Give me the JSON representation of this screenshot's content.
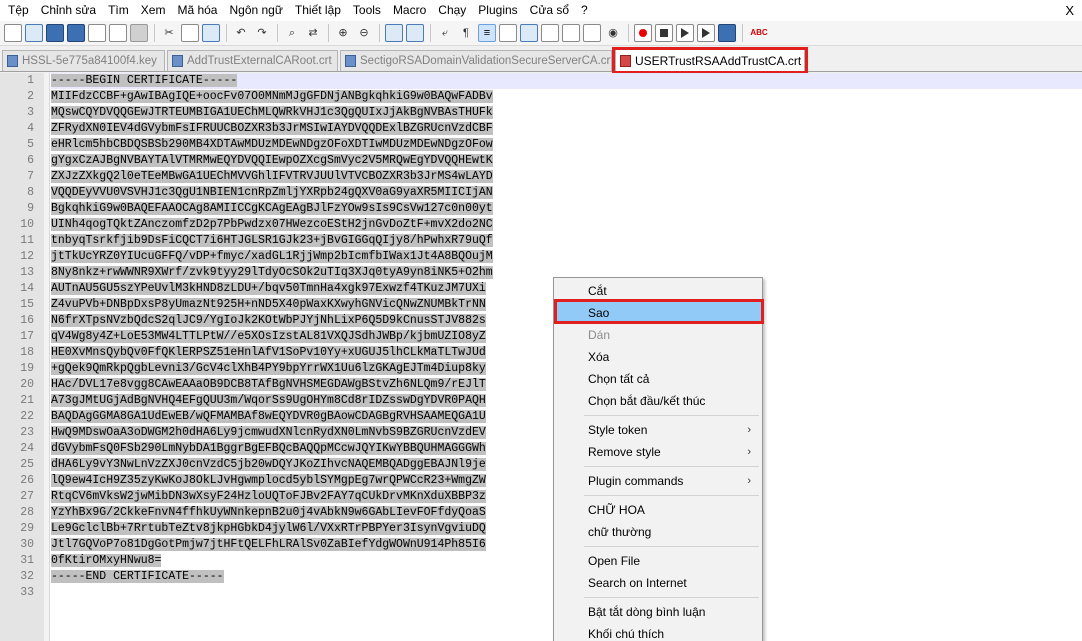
{
  "menu": {
    "items": [
      "Tệp",
      "Chỉnh sửa",
      "Tìm",
      "Xem",
      "Mã hóa",
      "Ngôn ngữ",
      "Thiết lập",
      "Tools",
      "Macro",
      "Chạy",
      "Plugins",
      "Cửa sổ",
      "?"
    ],
    "close_symbol": "X"
  },
  "toolbar": {
    "spellcheck_label": "ABC"
  },
  "tabs": [
    {
      "label": "HSSL-5e775a84100f4.key",
      "active": false
    },
    {
      "label": "AddTrustExternalCARoot.crt",
      "active": false
    },
    {
      "label": "SectigoRSADomainValidationSecureServerCA.crt",
      "active": false
    },
    {
      "label": "USERTrustRSAAddTrustCA.crt",
      "active": true,
      "close": "✕"
    }
  ],
  "editor": {
    "line_numbers": [
      "1",
      "2",
      "3",
      "4",
      "5",
      "6",
      "7",
      "8",
      "9",
      "10",
      "11",
      "12",
      "13",
      "14",
      "15",
      "16",
      "17",
      "18",
      "19",
      "20",
      "21",
      "22",
      "23",
      "24",
      "25",
      "26",
      "27",
      "28",
      "29",
      "30",
      "31",
      "32",
      "33"
    ],
    "lines": [
      "-----BEGIN CERTIFICATE-----",
      "MIIFdzCCBF+gAwIBAgIQE+oocFv07O0MNmMJgGFDNjANBgkqhkiG9w0BAQwFADBv",
      "MQswCQYDVQQGEwJTRTEUMBIGA1UEChMLQWRkVHJ1c3QgQUIxJjAkBgNVBAsTHUFk",
      "ZFRydXN0IEV4dGVybmFsIFRUUCBOZXR3b3JrMSIwIAYDVQQDExlBZGRUcnVzdCBF",
      "eHRlcm5hbCBDQSBSb290MB4XDTAwMDUzMDEwNDgzOFoXDTIwMDUzMDEwNDgzOFow",
      "gYgxCzAJBgNVBAYTAlVTMRMwEQYDVQQIEwpOZXcgSmVyc2V5MRQwEgYDVQQHEwtK",
      "ZXJzZXkgQ2l0eTEeMBwGA1UEChMVVGhlIFVTRVJUUlVTVCBOZXR3b3JrMS4wLAYD",
      "VQQDEyVVU0VSVHJ1c3QgU1NBIEN1cnRpZmljYXRpb24gQXV0aG9yaXR5MIICIjAN",
      "BgkqhkiG9w0BAQEFAAOCAg8AMIICCgKCAgEAgBJlFzYOw9sIs9CsVw127c0n00yt",
      "UINh4qogTQktZAnczomfzD2p7PbPwdzx07HWezcoEStH2jnGvDoZtF+mvX2do2NC",
      "tnbyqTsrkfjib9DsFiCQCT7i6HTJGLSR1GJk23+jBvGIGGqQIjy8/hPwhxR79uQf",
      "jtTkUcYRZ0YIUcuGFFQ/vDP+fmyc/xadGL1RjjWmp2bIcmfbIWax1Jt4A8BQOujM",
      "8Ny8nkz+rwWWNR9XWrf/zvk9tyy29lTdyOcSOk2uTIq3XJq0tyA9yn8iNK5+O2hm",
      "AUTnAU5GU5szYPeUvlM3kHND8zLDU+/bqv50TmnHa4xgk97Exwzf4TKuzJM7UXi",
      "Z4vuPVb+DNBpDxsP8yUmazNt925H+nND5X40pWaxKXwyhGNVicQNwZNUMBkTrNN",
      "N6frXTpsNVzbQdcS2qlJC9/YgIoJk2KOtWbPJYjNhLixP6Q5D9kCnusSTJV882s",
      "qV4Wg8y4Z+LoE53MW4LTTLPtW//e5XOsIzstAL81VXQJSdhJWBp/kjbmUZIO8yZ",
      "HE0XvMnsQybQv0FfQKlERPSZ51eHnlAfV1SoPv10Yy+xUGUJ5lhCLkMaTLTwJUd",
      "+gQek9QmRkpQgbLevni3/GcV4clXhB4PY9bpYrrWX1Uu6lzGKAgEJTm4Diup8ky",
      "HAc/DVL17e8vgg8CAwEAAaOB9DCB8TAfBgNVHSMEGDAWgBStvZh6NLQm9/rEJlT",
      "A73gJMtUGjAdBgNVHQ4EFgQUU3m/WqorSs9UgOHYm8Cd8rIDZsswDgYDVR0PAQH",
      "BAQDAgGGMA8GA1UdEwEB/wQFMAMBAf8wEQYDVR0gBAowCDAGBgRVHSAAMEQGA1U",
      "HwQ9MDswOaA3oDWGM2h0dHA6Ly9jcmwudXNlcnRydXN0LmNvbS9BZGRUcnVzdEV",
      "dGVybmFsQ0FSb290LmNybDA1BggrBgEFBQcBAQQpMCcwJQYIKwYBBQUHMAGGGWh",
      "dHA6Ly9vY3NwLnVzZXJ0cnVzdC5jb20wDQYJKoZIhvcNAQEMBQADggEBAJNl9je",
      "lQ9ew4IcH9Z35zyKwKoJ8OkLJvHgwmplocd5yblSYMgpEg7wrQPWCcR23+WmgZW",
      "RtqCV6mVksW2jwMibDN3wXsyF24HzloUQToFJBv2FAY7qCUkDrvMKnXduXBBP3z",
      "YzYhBx9G/2CkkeFnvN4ffhkUyWNnkepnB2u0j4vAbkN9w6GAbLIevFOFfdyQoaS",
      "Le9GclclBb+7RrtubTeZtv8jkpHGbkD4jylW6l/VXxRTrPBPYer3IsynVgviuDQ",
      "Jtl7GQVoP7o81DgGotPmjw7jtHFtQELFhLRAlSv0ZaBIefYdgWOWnU914Ph85I6",
      "0fKtirOMxyHNwu8=",
      "-----END CERTIFICATE-----",
      ""
    ]
  },
  "context_menu": {
    "cut": "Cắt",
    "copy": "Sao",
    "paste": "Dán",
    "delete": "Xóa",
    "select_all": "Chọn tất cả",
    "begin_end_select": "Chọn bắt đầu/kết thúc",
    "style_token": "Style token",
    "remove_style": "Remove style",
    "plugin_commands": "Plugin commands",
    "uppercase": "CHỮ HOA",
    "lowercase": "chữ thường",
    "open_file": "Open File",
    "search_internet": "Search on Internet",
    "toggle_comment": "Bật tắt dòng bình luận",
    "block_comment": "Khối chú thích",
    "submenu_arrow": "›"
  }
}
